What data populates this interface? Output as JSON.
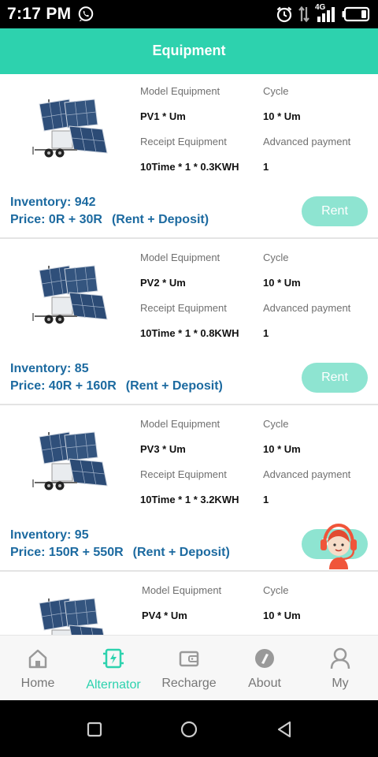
{
  "status_bar": {
    "time": "7:17 PM",
    "network": "4G",
    "icons": [
      "whatsapp-icon",
      "alarm-icon",
      "data-transfer-icon",
      "signal-icon",
      "battery-icon"
    ]
  },
  "header": {
    "title": "Equipment"
  },
  "labels": {
    "model": "Model Equipment",
    "cycle": "Cycle",
    "receipt": "Receipt Equipment",
    "advanced": "Advanced payment",
    "rent": "Rent",
    "rent_deposit": "(Rent + Deposit)"
  },
  "items": [
    {
      "model": "PV1 * Um",
      "cycle": "10 * Um",
      "receipt": "10Time * 1 * 0.3KWH",
      "advanced": "1",
      "inventory": "Inventory: 942",
      "price": "Price: 0R + 30R"
    },
    {
      "model": "PV2 * Um",
      "cycle": "10 * Um",
      "receipt": "10Time * 1 * 0.8KWH",
      "advanced": "1",
      "inventory": "Inventory: 85",
      "price": "Price: 40R + 160R"
    },
    {
      "model": "PV3 * Um",
      "cycle": "10 * Um",
      "receipt": "10Time * 1 * 3.2KWH",
      "advanced": "1",
      "inventory": "Inventory: 95",
      "price": "Price: 150R + 550R"
    },
    {
      "model": "PV4 * Um",
      "cycle": "10 * Um"
    }
  ],
  "nav": [
    {
      "label": "Home",
      "icon": "home-icon"
    },
    {
      "label": "Alternator",
      "icon": "alternator-icon",
      "active": true
    },
    {
      "label": "Recharge",
      "icon": "wallet-icon"
    },
    {
      "label": "About",
      "icon": "about-icon"
    },
    {
      "label": "My",
      "icon": "user-icon"
    }
  ],
  "colors": {
    "accent": "#2dd2ae",
    "rent_button": "#8ee4d1",
    "inventory_text": "#1c6aa0"
  }
}
